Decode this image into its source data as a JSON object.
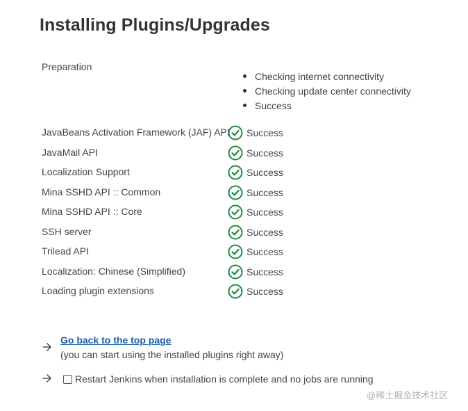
{
  "page": {
    "title": "Installing Plugins/Upgrades"
  },
  "preparation": {
    "label": "Preparation",
    "steps": [
      "Checking internet connectivity",
      "Checking update center connectivity",
      "Success"
    ]
  },
  "plugins": [
    {
      "name": "JavaBeans Activation Framework (JAF) API",
      "status": "Success"
    },
    {
      "name": "JavaMail API",
      "status": "Success"
    },
    {
      "name": "Localization Support",
      "status": "Success"
    },
    {
      "name": "Mina SSHD API :: Common",
      "status": "Success"
    },
    {
      "name": "Mina SSHD API :: Core",
      "status": "Success"
    },
    {
      "name": "SSH server",
      "status": "Success"
    },
    {
      "name": "Trilead API",
      "status": "Success"
    },
    {
      "name": "Localization: Chinese (Simplified)",
      "status": "Success"
    },
    {
      "name": "Loading plugin extensions",
      "status": "Success"
    }
  ],
  "actions": {
    "top_link": "Go back to the top page",
    "top_note": "(you can start using the installed plugins right away)",
    "restart_label": "Restart Jenkins when installation is complete and no jobs are running",
    "restart_checked": false
  },
  "icons": {
    "status_icon": "check-circle-icon",
    "arrow_icon": "arrow-right-icon"
  },
  "colors": {
    "success": "#1e8a3e",
    "link": "#1a5fa8"
  },
  "watermark": "@稀土掘金技术社区"
}
